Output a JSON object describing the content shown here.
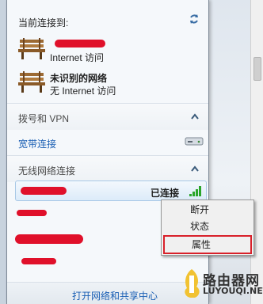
{
  "panel": {
    "header": "当前连接到:",
    "connected": [
      {
        "name": "",
        "status": "Internet 访问"
      },
      {
        "name": "未识别的网络",
        "status": "无 Internet 访问"
      }
    ],
    "sections": {
      "dialup": "拨号和 VPN",
      "broadband": "宽带连接",
      "wireless": "无线网络连接"
    },
    "wifi_selected_status": "已连接",
    "footer_link": "打开网络和共享中心"
  },
  "context_menu": {
    "items": [
      "断开",
      "状态",
      "属性"
    ],
    "highlighted": "属性"
  },
  "watermark": {
    "line1": "路由器网",
    "line2": "LUYOUQI.NET"
  },
  "colors": {
    "accent_link": "#1a5fb4",
    "redaction": "#e0102a",
    "highlight_box": "#d8202a",
    "signal_green": "#2aa52a"
  }
}
